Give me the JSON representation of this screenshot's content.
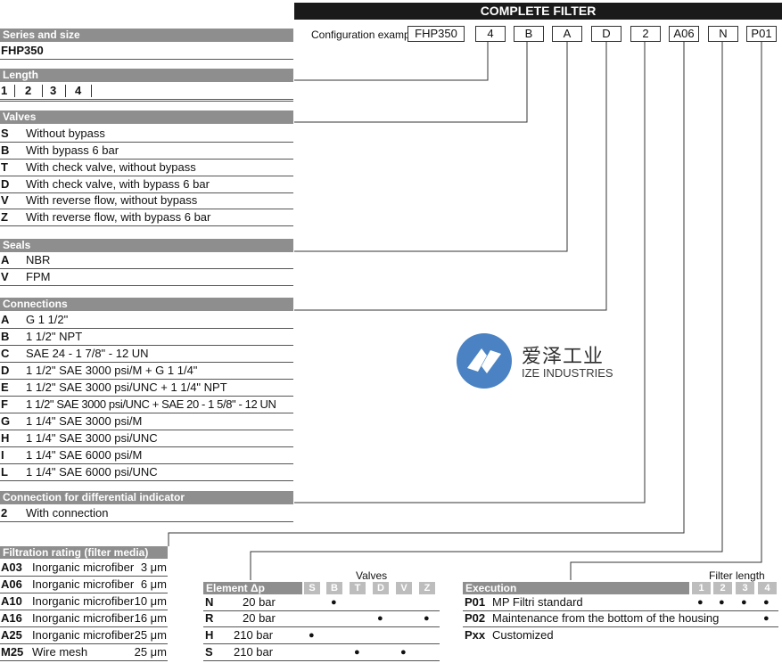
{
  "title": "COMPLETE FILTER",
  "config_label": "Configuration example:",
  "config_boxes": [
    "FHP350",
    "4",
    "B",
    "A",
    "D",
    "2",
    "A06",
    "N",
    "P01"
  ],
  "series": {
    "header": "Series and size",
    "value": "FHP350"
  },
  "length": {
    "header": "Length",
    "values": [
      "1",
      "2",
      "3",
      "4"
    ]
  },
  "valves": {
    "header": "Valves",
    "items": [
      {
        "code": "S",
        "desc": "Without bypass"
      },
      {
        "code": "B",
        "desc": "With bypass 6 bar"
      },
      {
        "code": "T",
        "desc": "With check valve, without bypass"
      },
      {
        "code": "D",
        "desc": "With check valve, with bypass 6 bar"
      },
      {
        "code": "V",
        "desc": "With reverse flow, without bypass"
      },
      {
        "code": "Z",
        "desc": "With reverse flow, with bypass 6 bar"
      }
    ]
  },
  "seals": {
    "header": "Seals",
    "items": [
      {
        "code": "A",
        "desc": "NBR"
      },
      {
        "code": "V",
        "desc": "FPM"
      }
    ]
  },
  "connections": {
    "header": "Connections",
    "items": [
      {
        "code": "A",
        "desc": "G 1 1/2\""
      },
      {
        "code": "B",
        "desc": "1 1/2\" NPT"
      },
      {
        "code": "C",
        "desc": "SAE 24 - 1 7/8\" - 12 UN"
      },
      {
        "code": "D",
        "desc": "1 1/2\" SAE 3000 psi/M + G 1 1/4\""
      },
      {
        "code": "E",
        "desc": "1 1/2\" SAE 3000 psi/UNC + 1 1/4\" NPT"
      },
      {
        "code": "F",
        "desc": "1 1/2\" SAE 3000 psi/UNC + SAE 20 - 1 5/8\" - 12 UN"
      },
      {
        "code": "G",
        "desc": "1 1/4\" SAE 3000 psi/M"
      },
      {
        "code": "H",
        "desc": "1 1/4\" SAE 3000 psi/UNC"
      },
      {
        "code": "I",
        "desc": "1 1/4\" SAE 6000 psi/M"
      },
      {
        "code": "L",
        "desc": "1 1/4\" SAE 6000 psi/UNC"
      }
    ]
  },
  "diff_indicator": {
    "header": "Connection for differential indicator",
    "items": [
      {
        "code": "2",
        "desc": "With connection"
      }
    ]
  },
  "filtration": {
    "header": "Filtration rating (filter media)",
    "items": [
      {
        "code": "A03",
        "desc": "Inorganic microfiber",
        "rating": "3 μm"
      },
      {
        "code": "A06",
        "desc": "Inorganic microfiber",
        "rating": "6 μm"
      },
      {
        "code": "A10",
        "desc": "Inorganic microfiber",
        "rating": "10 μm"
      },
      {
        "code": "A16",
        "desc": "Inorganic microfiber",
        "rating": "16 μm"
      },
      {
        "code": "A25",
        "desc": "Inorganic microfiber",
        "rating": "25 μm"
      },
      {
        "code": "M25",
        "desc": "Wire mesh",
        "rating": "25 μm"
      }
    ]
  },
  "element": {
    "top_label": "Valves",
    "header": "Element Δp",
    "valve_cols": [
      "S",
      "B",
      "T",
      "D",
      "V",
      "Z"
    ],
    "items": [
      {
        "code": "N",
        "desc": "20 bar",
        "dots": [
          false,
          true,
          false,
          false,
          false,
          false
        ]
      },
      {
        "code": "R",
        "desc": "20 bar",
        "dots": [
          false,
          false,
          false,
          true,
          false,
          true
        ]
      },
      {
        "code": "H",
        "desc": "210 bar",
        "dots": [
          true,
          false,
          false,
          false,
          false,
          false
        ]
      },
      {
        "code": "S",
        "desc": "210 bar",
        "dots": [
          false,
          false,
          true,
          false,
          true,
          false
        ]
      }
    ]
  },
  "execution": {
    "top_label": "Filter length",
    "header": "Execution",
    "length_cols": [
      "1",
      "2",
      "3",
      "4"
    ],
    "items": [
      {
        "code": "P01",
        "desc": "MP Filtri standard",
        "dots": [
          true,
          true,
          true,
          true
        ]
      },
      {
        "code": "P02",
        "desc": "Maintenance from the bottom of the housing",
        "dots": [
          false,
          false,
          false,
          true
        ]
      },
      {
        "code": "Pxx",
        "desc": "Customized",
        "dots": [
          false,
          false,
          false,
          false
        ]
      }
    ]
  },
  "dot_glyph": "●",
  "watermark": {
    "cn": "爱泽工业",
    "en": "IZE INDUSTRIES",
    "color": "#4a82c3"
  }
}
